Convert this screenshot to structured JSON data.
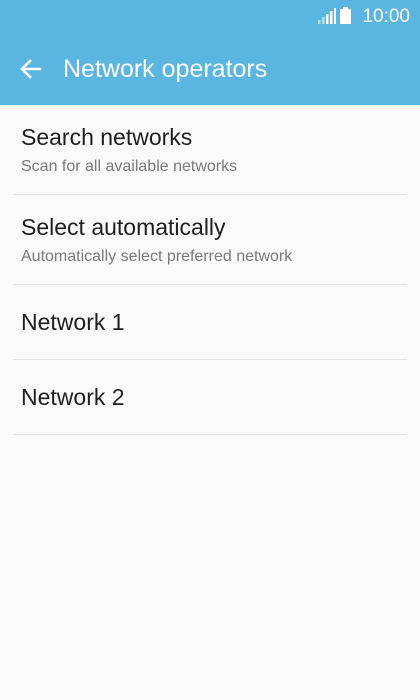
{
  "status_bar": {
    "time": "10:00",
    "signal_icon": "signal-icon",
    "battery_icon": "battery-icon"
  },
  "toolbar": {
    "title": "Network operators",
    "back_icon": "back-arrow-icon"
  },
  "list": {
    "items": [
      {
        "title": "Search networks",
        "subtitle": "Scan for all available networks"
      },
      {
        "title": "Select automatically",
        "subtitle": "Automatically select preferred network"
      },
      {
        "title": "Network 1"
      },
      {
        "title": "Network 2"
      }
    ]
  },
  "colors": {
    "app_bar": "#5ab6e0",
    "background": "#fafafa",
    "divider": "#e3e3e3",
    "primary_text": "#1e1e1e",
    "secondary_text": "#7a7a7a"
  }
}
